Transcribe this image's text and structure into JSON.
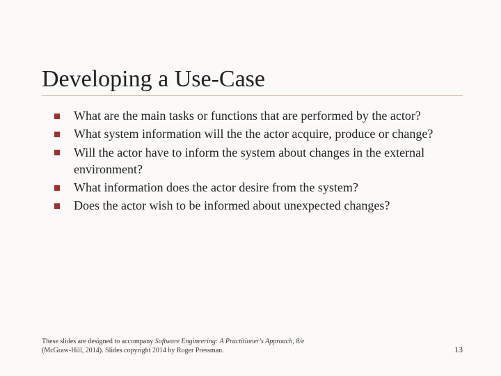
{
  "title": "Developing a Use-Case",
  "bullets": [
    "What are the main tasks or functions that are performed by the actor?",
    "What system information will the the actor acquire, produce or change?",
    "Will the actor have to inform the system about changes in the external environment?",
    "What information does the actor desire from the system?",
    "Does the actor wish to be informed about unexpected changes?"
  ],
  "footer": {
    "line1_a": "These slides are designed to accompany ",
    "line1_b": "Software Engineering: A Practitioner's Approach, 8/e ",
    "line2": "(McGraw-Hill, 2014). Slides copyright 2014 by Roger Pressman."
  },
  "page_number": "13"
}
